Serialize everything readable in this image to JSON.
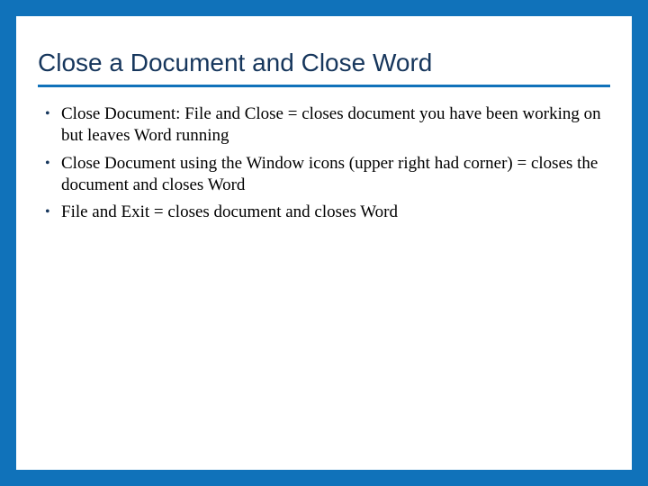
{
  "slide": {
    "title": "Close a Document and Close Word",
    "bullets": [
      "Close Document:  File and Close = closes document you have been working on but leaves Word running",
      "Close Document using the Window icons (upper right had corner) = closes the document and closes Word",
      "File and Exit = closes document and closes Word"
    ]
  }
}
